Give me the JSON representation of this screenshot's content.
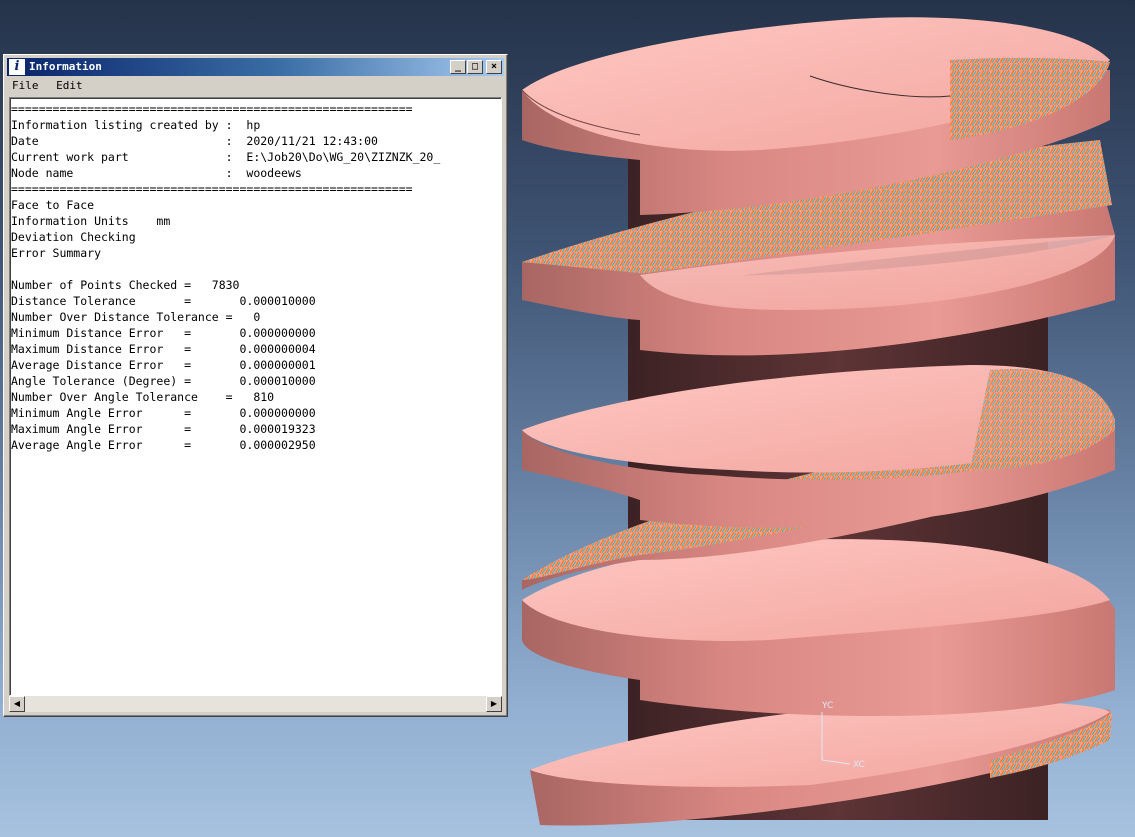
{
  "window": {
    "title": "Information",
    "icon": "info-icon",
    "buttons": [
      "minimize-icon",
      "maximize-icon",
      "close-icon"
    ]
  },
  "menu": [
    "File",
    "Edit"
  ],
  "listing": {
    "lines": [
      "==========================================================",
      "Information listing created by :  hp",
      "Date                           :  2020/11/21 12:43:00",
      "Current work part              :  E:\\Job20\\Do\\WG_20\\ZIZNZK_20_",
      "Node name                      :  woodeews",
      "==========================================================",
      "Face to Face",
      "Information Units    mm",
      "Deviation Checking",
      "Error Summary",
      "",
      "Number of Points Checked =   7830",
      "Distance Tolerance       =       0.000010000",
      "Number Over Distance Tolerance =   0",
      "Minimum Distance Error   =       0.000000000",
      "Maximum Distance Error   =       0.000000004",
      "Average Distance Error   =       0.000000001",
      "Angle Tolerance (Degree) =       0.000010000",
      "Number Over Angle Tolerance    =   810",
      "Minimum Angle Error      =       0.000000000",
      "Maximum Angle Error      =       0.000019323",
      "Average Angle Error      =       0.000002950"
    ]
  },
  "viewport": {
    "axis_labels": {
      "y": "YC",
      "x": "XC"
    },
    "colors": {
      "model_face": "#f7b1ab",
      "model_side_light": "#e48a86",
      "model_side_dark": "#8b4e4e",
      "model_root": "#4a2a2c",
      "deviation_needles_a": "#ff7a1a",
      "deviation_needles_b": "#27b7c9"
    }
  }
}
